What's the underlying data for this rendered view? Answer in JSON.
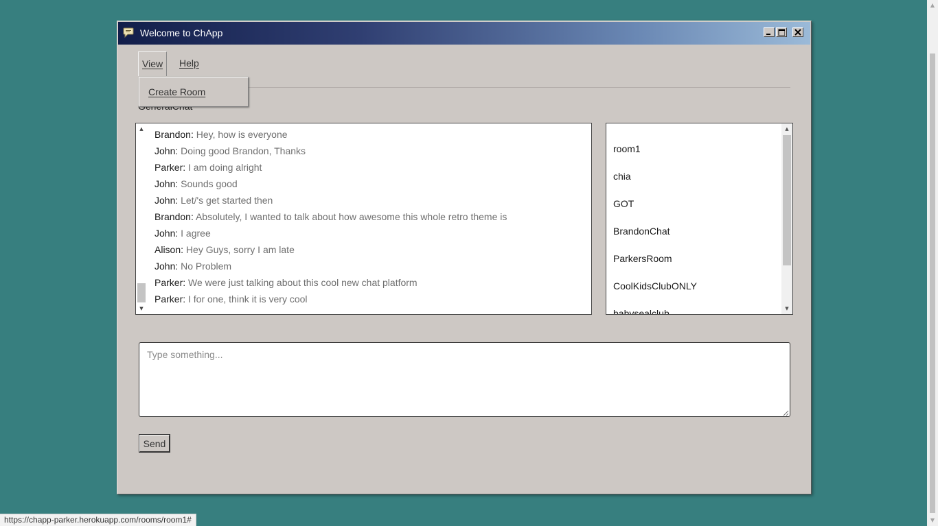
{
  "window": {
    "title": "Welcome to ChApp",
    "controls": {
      "minimize": "minimize",
      "maximize": "maximize",
      "close": "close"
    }
  },
  "menu": {
    "items": [
      {
        "label": "View",
        "open": true
      },
      {
        "label": "Help",
        "open": false
      }
    ],
    "dropdown": {
      "items": [
        {
          "label": "Create Room"
        }
      ]
    }
  },
  "room_heading": "GeneralChat",
  "chat": {
    "messages": [
      {
        "author": "Brandon",
        "text": "Hey, how is everyone"
      },
      {
        "author": "John",
        "text": "Doing good Brandon, Thanks"
      },
      {
        "author": "Parker",
        "text": "I am doing alright"
      },
      {
        "author": "John",
        "text": "Sounds good"
      },
      {
        "author": "John",
        "text": "Let/'s get started then"
      },
      {
        "author": "Brandon",
        "text": "Absolutely, I wanted to talk about how awesome this whole retro theme is"
      },
      {
        "author": "John",
        "text": "I agree"
      },
      {
        "author": "Alison",
        "text": "Hey Guys, sorry I am late"
      },
      {
        "author": "John",
        "text": "No Problem"
      },
      {
        "author": "Parker",
        "text": "We were just talking about this cool new chat platform"
      },
      {
        "author": "Parker",
        "text": "I for one, think it is very cool"
      }
    ]
  },
  "rooms": [
    "room1",
    "chia",
    "GOT",
    "BrandonChat",
    "ParkersRoom",
    "CoolKidsClubONLY",
    "babysealclub"
  ],
  "composer": {
    "placeholder": "Type something...",
    "value": ""
  },
  "send_label": "Send",
  "status_url": "https://chapp-parker.herokuapp.com/rooms/room1#",
  "colors": {
    "desktop": "#377f7f",
    "window_bg": "#cdc8c4",
    "title_gradient_start": "#121e4a",
    "title_gradient_end": "#9bbad8"
  }
}
